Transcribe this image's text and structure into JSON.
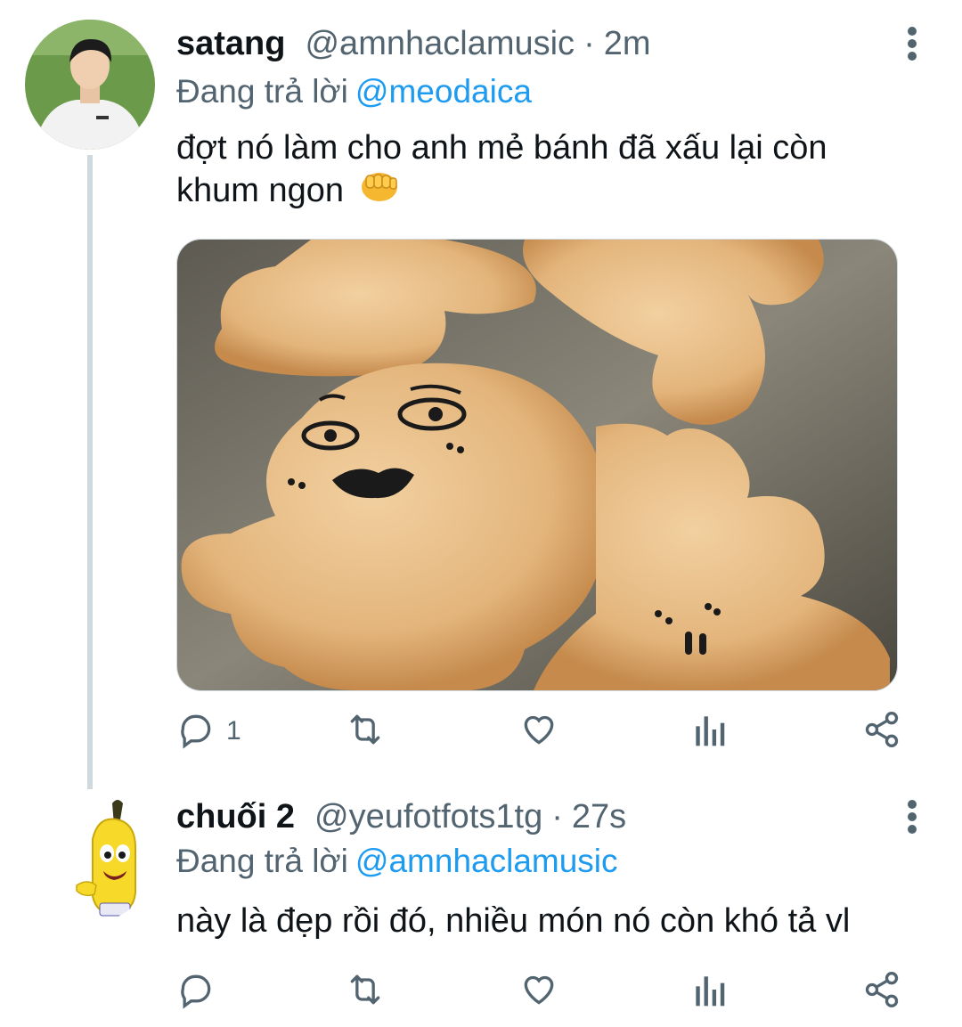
{
  "tweets": [
    {
      "name": "satang",
      "handle": "@amnhaclamusic",
      "separator": "·",
      "time": "2m",
      "replying_label": "Đang trả lời",
      "replying_to": "@meodaica",
      "text": "đợt nó làm cho anh mẻ bánh đã xấu lại còn khum ngon",
      "emoji_icon": "oncoming-fist-icon",
      "reply_count": "1"
    },
    {
      "name": "chuối 2",
      "handle": "@yeufotfots1tg",
      "separator": "·",
      "time": "27s",
      "replying_label": "Đang trả lời",
      "replying_to": "@amnhaclamusic",
      "text": "này là đẹp rồi đó, nhiều món nó còn khó tả vl",
      "reply_count": ""
    }
  ],
  "colors": {
    "link": "#1d9bf0",
    "muted": "#536471",
    "text": "#0f1419",
    "thread_line": "#cfd9de"
  }
}
